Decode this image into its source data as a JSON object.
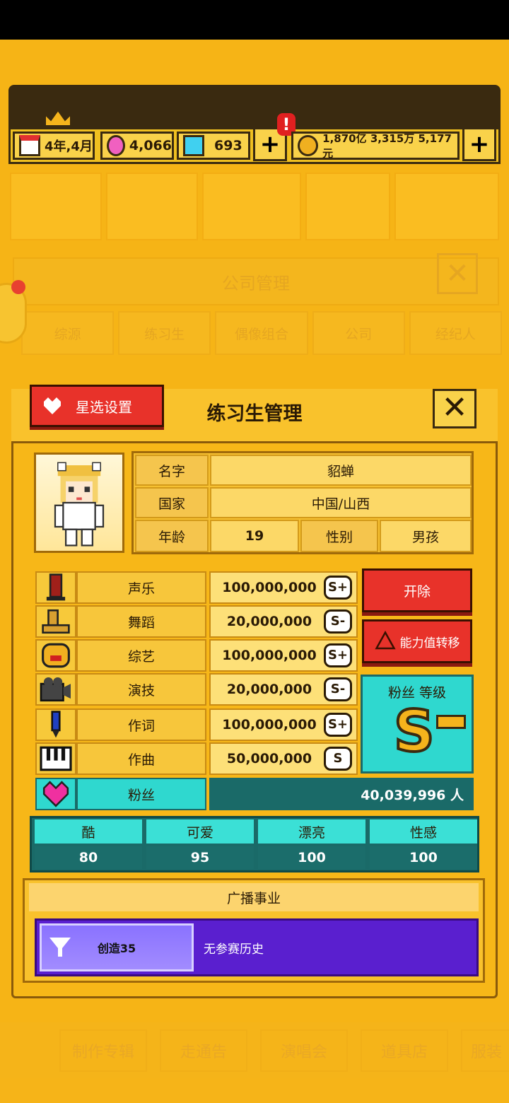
{
  "hud": {
    "date": "4年,4月",
    "gems": "4,066",
    "diamonds": "693",
    "money": "1,870亿 3,315万 5,177元",
    "alert": "!",
    "plus": "+"
  },
  "background": {
    "company_title": "公司管理",
    "tabs": [
      "综源",
      "练习生",
      "偶像组合",
      "公司",
      "经纪人"
    ],
    "nav": [
      "制作专辑",
      "走通告",
      "演唱会",
      "道具店",
      "服装"
    ]
  },
  "modal": {
    "title": "练习生管理",
    "star_button": "星选设置",
    "close": "✕",
    "info": {
      "name_label": "名字",
      "name_value": "貂蝉",
      "country_label": "国家",
      "country_value": "中国/山西",
      "age_label": "年龄",
      "age_value": "19",
      "gender_label": "性别",
      "gender_value": "男孩"
    },
    "stats": [
      {
        "name": "声乐",
        "value": "100,000,000",
        "grade": "S+"
      },
      {
        "name": "舞蹈",
        "value": "20,000,000",
        "grade": "S-"
      },
      {
        "name": "综艺",
        "value": "100,000,000",
        "grade": "S+"
      },
      {
        "name": "演技",
        "value": "20,000,000",
        "grade": "S-"
      },
      {
        "name": "作词",
        "value": "100,000,000",
        "grade": "S+"
      },
      {
        "name": "作曲",
        "value": "50,000,000",
        "grade": "S"
      }
    ],
    "dismiss_button": "开除",
    "transfer_button": "能力值转移",
    "fan_level_title": "粉丝 等级",
    "fan_level": "S",
    "fans_label": "粉丝",
    "fans_value": "40,039,996 人",
    "attributes": [
      {
        "name": "酷",
        "value": "80"
      },
      {
        "name": "可爱",
        "value": "95"
      },
      {
        "name": "漂亮",
        "value": "100"
      },
      {
        "name": "性感",
        "value": "100"
      }
    ],
    "career_title": "广播事业",
    "career_button": "创造35",
    "career_text": "无参赛历史"
  },
  "colors": {
    "accent": "#f6b416",
    "red": "#e8322a",
    "teal": "#2fd8cf",
    "purple": "#5a1fcf"
  }
}
